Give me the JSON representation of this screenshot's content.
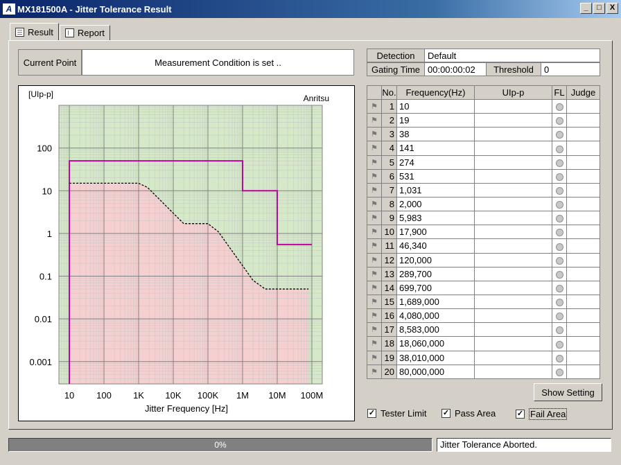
{
  "window": {
    "title": "MX181500A - Jitter Tolerance Result",
    "logo": "A",
    "minimize": "_",
    "maximize": "□",
    "close": "X"
  },
  "tabs": [
    {
      "label": "Result",
      "icon": "grid-icon"
    },
    {
      "label": "Report",
      "icon": "document-icon"
    }
  ],
  "current_point": {
    "label": "Current Point",
    "value": "Measurement Condition is set .."
  },
  "detection": {
    "label": "Detection",
    "value": "Default",
    "gating_label": "Gating Time",
    "gating_value": "00:00:00:02",
    "threshold_label": "Threshold",
    "threshold_value": "0"
  },
  "chart_data": {
    "type": "line",
    "brand": "Anritsu",
    "ylabel": "[UIp-p]",
    "xlabel": "Jitter Frequency [Hz]",
    "x_ticks": [
      "10",
      "100",
      "1K",
      "10K",
      "100K",
      "1M",
      "10M",
      "100M"
    ],
    "y_ticks": [
      "100",
      "10",
      "1",
      "0.1",
      "0.01",
      "0.001"
    ],
    "x_scale": "log",
    "y_scale": "log",
    "xlim": [
      5,
      200000000
    ],
    "ylim": [
      0.0003,
      1000
    ],
    "colors": {
      "pass_area": "#d5e9c8",
      "fail_area": "#f6d0d0",
      "tester_limit": "#c000a0",
      "mask": "#000000"
    },
    "series": [
      {
        "x": [
          10,
          10,
          1000000,
          1000000,
          10000000,
          10000000,
          100000000
        ],
        "y": [
          0.0003,
          50,
          50,
          10,
          10,
          0.55,
          0.55
        ],
        "style": "solid"
      },
      {
        "x": [
          10,
          1000,
          1800,
          20000,
          100000,
          200000,
          2000000,
          4500000,
          80000000
        ],
        "y": [
          15,
          15,
          12,
          1.7,
          1.7,
          1.1,
          0.08,
          0.05,
          0.05
        ],
        "style": "dashed"
      }
    ],
    "fail_boundary": {
      "x": [
        10,
        1000,
        1800,
        20000,
        100000,
        200000,
        2000000,
        4500000,
        80000000
      ],
      "y": [
        15,
        15,
        12,
        1.7,
        1.7,
        1.1,
        0.08,
        0.05,
        0.05
      ]
    }
  },
  "table": {
    "headers": [
      "No.",
      "Frequency(Hz)",
      "UIp-p",
      "FL",
      "Judge"
    ],
    "rows": [
      {
        "no": "1",
        "freq": "10"
      },
      {
        "no": "2",
        "freq": "19"
      },
      {
        "no": "3",
        "freq": "38"
      },
      {
        "no": "4",
        "freq": "141"
      },
      {
        "no": "5",
        "freq": "274"
      },
      {
        "no": "6",
        "freq": "531"
      },
      {
        "no": "7",
        "freq": "1,031"
      },
      {
        "no": "8",
        "freq": "2,000"
      },
      {
        "no": "9",
        "freq": "5,983"
      },
      {
        "no": "10",
        "freq": "17,900"
      },
      {
        "no": "11",
        "freq": "46,340"
      },
      {
        "no": "12",
        "freq": "120,000"
      },
      {
        "no": "13",
        "freq": "289,700"
      },
      {
        "no": "14",
        "freq": "699,700"
      },
      {
        "no": "15",
        "freq": "1,689,000"
      },
      {
        "no": "16",
        "freq": "4,080,000"
      },
      {
        "no": "17",
        "freq": "8,583,000"
      },
      {
        "no": "18",
        "freq": "18,060,000"
      },
      {
        "no": "19",
        "freq": "38,010,000"
      },
      {
        "no": "20",
        "freq": "80,000,000"
      }
    ]
  },
  "show_setting_label": "Show Setting",
  "checkboxes": [
    {
      "label": "Tester Limit",
      "checked": "✓"
    },
    {
      "label": "Pass Area",
      "checked": "✓"
    },
    {
      "label": "Fail Area",
      "checked": "✓"
    }
  ],
  "progress": {
    "value": 0,
    "text": "0%"
  },
  "status_text": "Jitter Tolerance Aborted."
}
